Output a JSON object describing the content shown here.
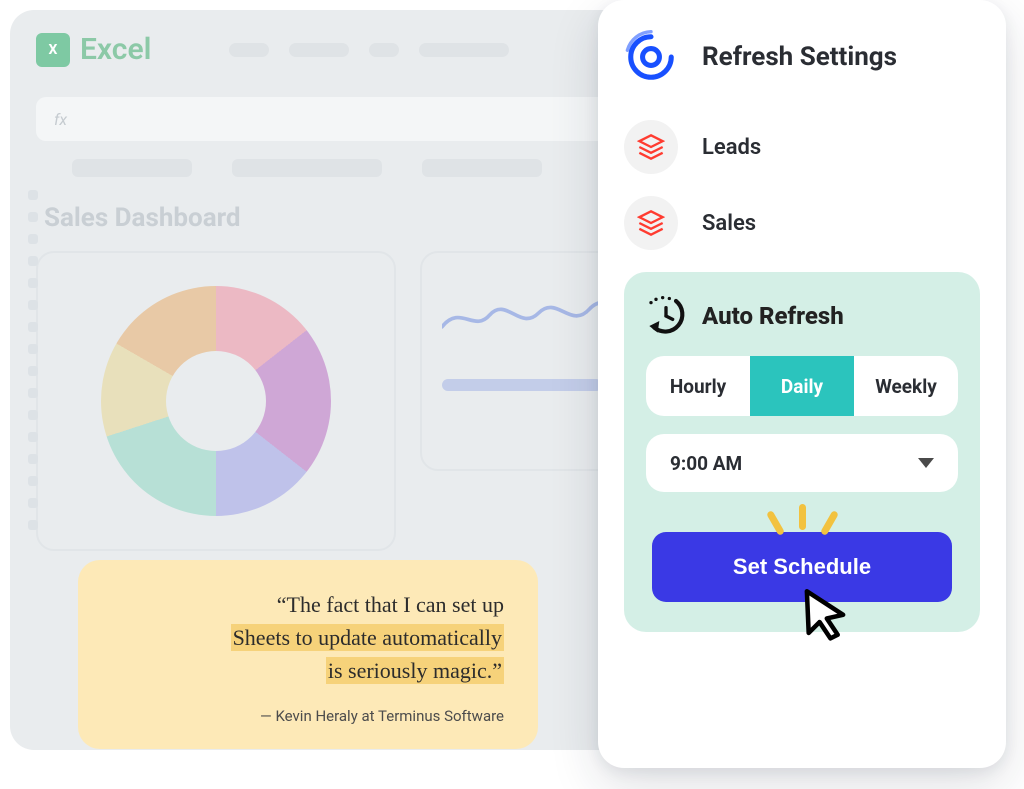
{
  "excel": {
    "brand": "Excel",
    "badge": "X",
    "fx": "fx",
    "dashboard_title": "Sales Dashboard"
  },
  "testimonial": {
    "quote_prefix": "“The fact that I can set up ",
    "quote_hl1": "Sheets to update automatically",
    "quote_hl2": "is seriously magic.”",
    "attribution": "— Kevin Heraly at Terminus Software"
  },
  "panel": {
    "title": "Refresh Settings",
    "sources": [
      {
        "label": "Leads"
      },
      {
        "label": "Sales"
      }
    ],
    "auto": {
      "title": "Auto Refresh",
      "segments": {
        "hourly": "Hourly",
        "daily": "Daily",
        "weekly": "Weekly"
      },
      "active_segment": "daily",
      "time": "9:00 AM",
      "cta": "Set Schedule"
    }
  },
  "colors": {
    "accent_blue": "#3a39e5",
    "teal": "#2bc4bd",
    "panel_mint": "#d4efe6",
    "highlight": "#f6d27a",
    "quote_bg": "#fde9b7"
  }
}
